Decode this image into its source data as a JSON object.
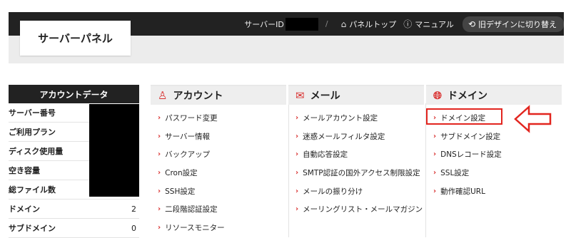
{
  "header": {
    "logo": "サーバーパネル",
    "server_id_label": "サーバーID",
    "panel_top": "パネルトップ",
    "manual": "マニュアル",
    "old_design": "旧デザインに切り替え"
  },
  "account": {
    "title": "アカウントデータ",
    "rows": [
      {
        "label": "サーバー番号",
        "value": ""
      },
      {
        "label": "ご利用プラン",
        "value": ""
      },
      {
        "label": "ディスク使用量",
        "value": ""
      },
      {
        "label": "空き容量",
        "value": ""
      },
      {
        "label": "総ファイル数",
        "value": ""
      },
      {
        "label": "ドメイン",
        "value": "2"
      },
      {
        "label": "サブドメイン",
        "value": "0"
      }
    ]
  },
  "columns": {
    "account": {
      "title": "アカウント",
      "items": [
        "パスワード変更",
        "サーバー情報",
        "バックアップ",
        "Cron設定",
        "SSH設定",
        "二段階認証設定",
        "リソースモニター"
      ]
    },
    "mail": {
      "title": "メール",
      "items": [
        "メールアカウント設定",
        "迷惑メールフィルタ設定",
        "自動応答設定",
        "SMTP認証の国外アクセス制限設定",
        "メールの振り分け",
        "メーリングリスト・メールマガジン"
      ]
    },
    "domain": {
      "title": "ドメイン",
      "items": [
        "ドメイン設定",
        "サブドメイン設定",
        "DNSレコード設定",
        "SSL設定",
        "動作確認URL"
      ]
    }
  },
  "colors": {
    "accent": "#d9302f",
    "header_bg": "#222222",
    "highlight": "#e2251f"
  }
}
